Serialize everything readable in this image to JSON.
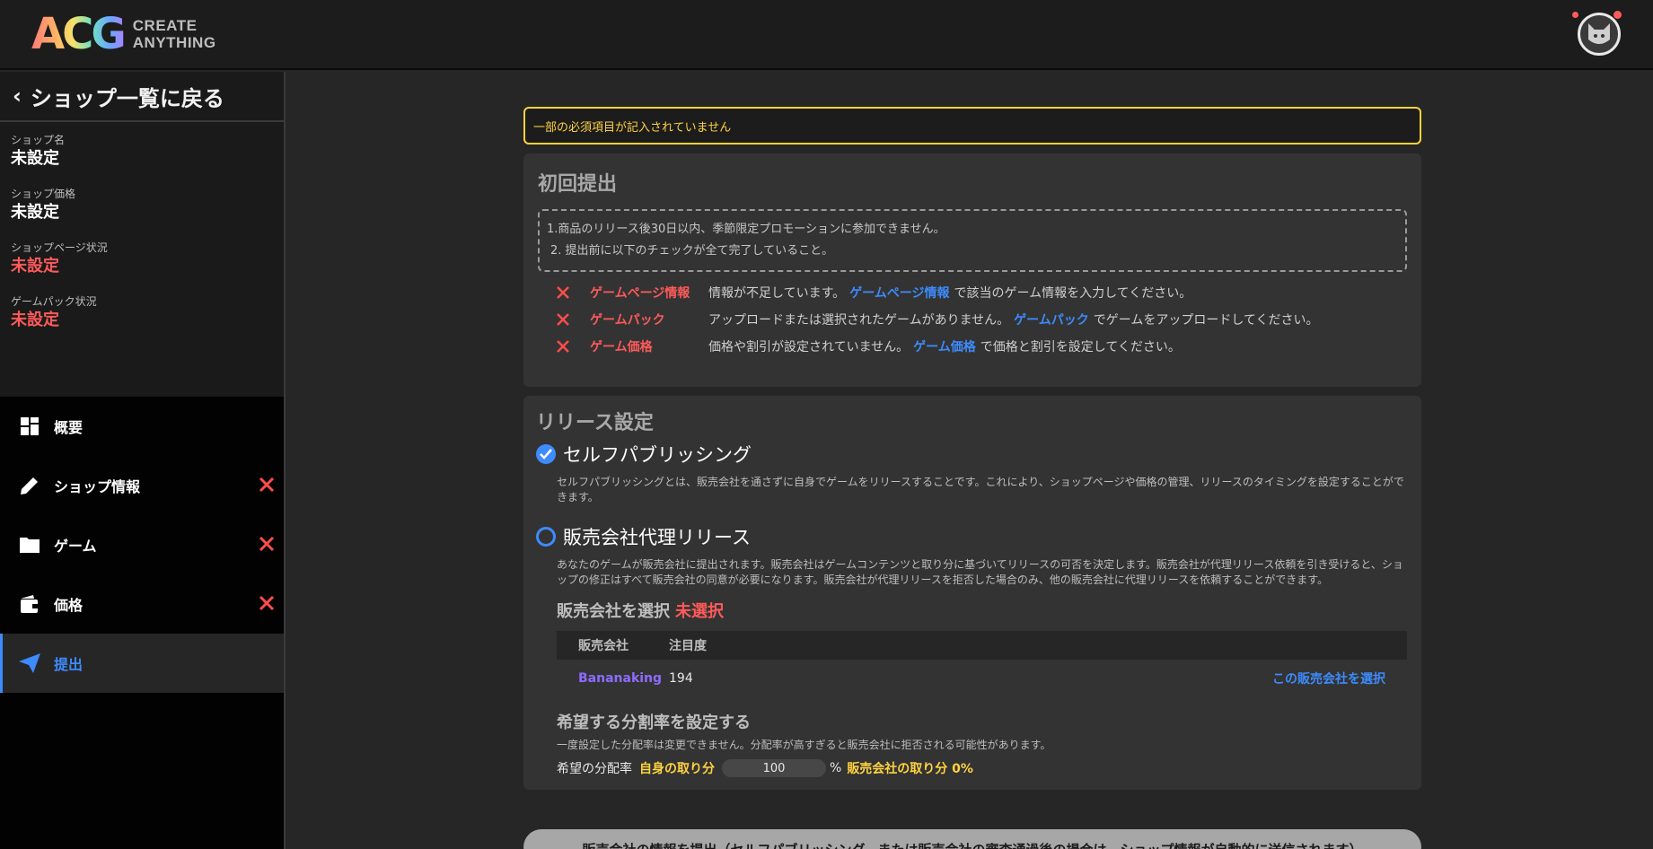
{
  "header": {
    "logo_mark": "ACG",
    "logo_line1": "CREATE",
    "logo_line2": "ANYTHING"
  },
  "sidebar": {
    "back_label": "ショップ一覧に戻る",
    "info": [
      {
        "label": "ショップ名",
        "value": "未設定",
        "status": "normal"
      },
      {
        "label": "ショップ価格",
        "value": "未設定",
        "status": "normal"
      },
      {
        "label": "ショップページ状況",
        "value": "未設定",
        "status": "error"
      },
      {
        "label": "ゲームパック状況",
        "value": "未設定",
        "status": "error"
      }
    ],
    "nav": [
      {
        "label": "概要",
        "icon": "grid-icon",
        "error": false,
        "active": false
      },
      {
        "label": "ショップ情報",
        "icon": "pencil-icon",
        "error": true,
        "active": false
      },
      {
        "label": "ゲーム",
        "icon": "folder-icon",
        "error": true,
        "active": false
      },
      {
        "label": "価格",
        "icon": "wallet-icon",
        "error": true,
        "active": false
      },
      {
        "label": "提出",
        "icon": "send-icon",
        "error": false,
        "active": true
      }
    ]
  },
  "main": {
    "warning": "一部の必須項目が記入されていません",
    "initial_submit": {
      "title": "初回提出",
      "notes": [
        "1.商品のリリース後30日以内、季節限定プロモーションに参加できません。",
        "2. 提出前に以下のチェックが全て完了していること。"
      ],
      "checks": [
        {
          "name": "ゲームページ情報",
          "before": "情報が不足しています。",
          "link": "ゲームページ情報",
          "after": "で該当のゲーム情報を入力してください。"
        },
        {
          "name": "ゲームパック",
          "before": "アップロードまたは選択されたゲームがありません。",
          "link": "ゲームパック",
          "after": "でゲームをアップロードしてください。"
        },
        {
          "name": "ゲーム価格",
          "before": "価格や割引が設定されていません。",
          "link": "ゲーム価格",
          "after": "で価格と割引を設定してください。"
        }
      ]
    },
    "release": {
      "title": "リリース設定",
      "self_publish": {
        "label": "セルフパブリッシング",
        "selected": true,
        "desc": "セルフパブリッシングとは、販売会社を通さずに自身でゲームをリリースすることです。これにより、ショップページや価格の管理、リリースのタイミングを設定することができます。"
      },
      "publisher": {
        "label": "販売会社代理リリース",
        "selected": false,
        "desc": "あなたのゲームが販売会社に提出されます。販売会社はゲームコンテンツと取り分に基づいてリリースの可否を決定します。販売会社が代理リリース依頼を引き受けると、ショップの修正はすべて販売会社の同意が必要になります。販売会社が代理リリースを拒否した場合のみ、他の販売会社に代理リリースを依頼することができます。"
      },
      "select_title": "販売会社を選択",
      "select_status": "未選択",
      "table_headers": [
        "販売会社",
        "注目度"
      ],
      "publishers": [
        {
          "name": "Bananaking",
          "attention": "194",
          "action": "この販売会社を選択"
        }
      ],
      "split_title": "希望する分割率を設定する",
      "split_note": "一度設定した分配率は変更できません。分配率が高すぎると販売会社に拒否される可能性があります。",
      "split_label": "希望の分配率",
      "own_share_label": "自身の取り分",
      "own_share_value": "100",
      "percent_sign": "%",
      "publisher_share_label": "販売会社の取り分 0%"
    },
    "submit_text": "販売会社の情報を提出（セルフパブリッシング、または販売会社の審査通過後の場合は、ショップ情報が自動的に送信されます）"
  }
}
